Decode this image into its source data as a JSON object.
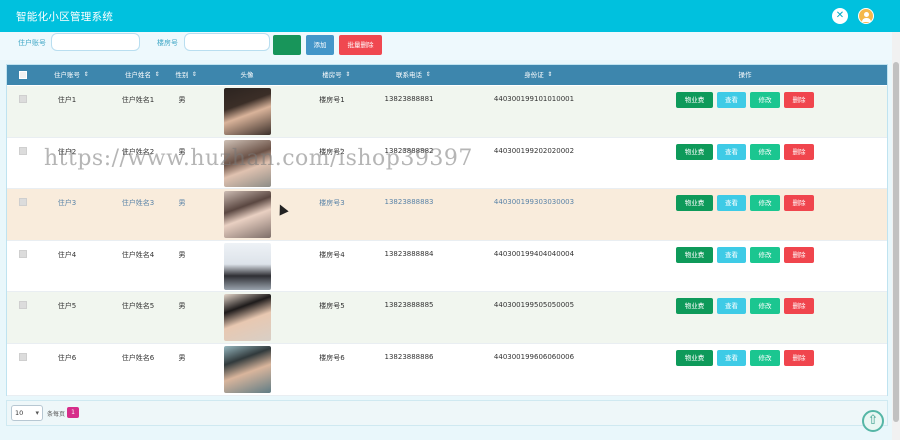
{
  "app": {
    "title": "智能化小区管理系统"
  },
  "search": {
    "account_label": "住户账号",
    "room_label": "楼房号",
    "account_value": "",
    "room_value": "",
    "search_button": "",
    "add_button": "添加",
    "batch_delete_button": "批量删除"
  },
  "table": {
    "headers": [
      "住户账号",
      "住户姓名",
      "性别",
      "头像",
      "楼房号",
      "联系电话",
      "身份证",
      "操作"
    ],
    "sort_marks": [
      "住户账号",
      "住户姓名",
      "性别",
      "楼房号",
      "联系电话",
      "身份证"
    ],
    "action_labels": {
      "fee": "物业费",
      "view": "查看",
      "edit": "修改",
      "delete": "删除"
    },
    "rows": [
      {
        "account": "住户1",
        "name": "住户姓名1",
        "gender": "男",
        "room": "楼房号1",
        "phone": "13823888881",
        "id": "440300199101010001",
        "bg": "#f1f6ef",
        "fg": "#333333"
      },
      {
        "account": "住户2",
        "name": "住户姓名2",
        "gender": "男",
        "room": "楼房号2",
        "phone": "13823888882",
        "id": "440300199202020002",
        "bg": "#ffffff",
        "fg": "#333333"
      },
      {
        "account": "住户3",
        "name": "住户姓名3",
        "gender": "男",
        "room": "楼房号3",
        "phone": "13823888883",
        "id": "440300199303030003",
        "bg": "#f9ecdc",
        "fg": "#5b84a8"
      },
      {
        "account": "住户4",
        "name": "住户姓名4",
        "gender": "男",
        "room": "楼房号4",
        "phone": "13823888884",
        "id": "440300199404040004",
        "bg": "#ffffff",
        "fg": "#333333"
      },
      {
        "account": "住户5",
        "name": "住户姓名5",
        "gender": "男",
        "room": "楼房号5",
        "phone": "13823888885",
        "id": "440300199505050005",
        "bg": "#f1f6ef",
        "fg": "#333333"
      },
      {
        "account": "住户6",
        "name": "住户姓名6",
        "gender": "男",
        "room": "楼房号6",
        "phone": "13823888886",
        "id": "440300199606060006",
        "bg": "#ffffff",
        "fg": "#333333"
      }
    ]
  },
  "pager": {
    "page_size": "10",
    "per_page_text": "条每页",
    "current_page": "1"
  },
  "watermark": "https://www.huzhan.com/ishop39397",
  "colors": {
    "topbar": "#00c1de",
    "table_header": "#3d86ad"
  }
}
